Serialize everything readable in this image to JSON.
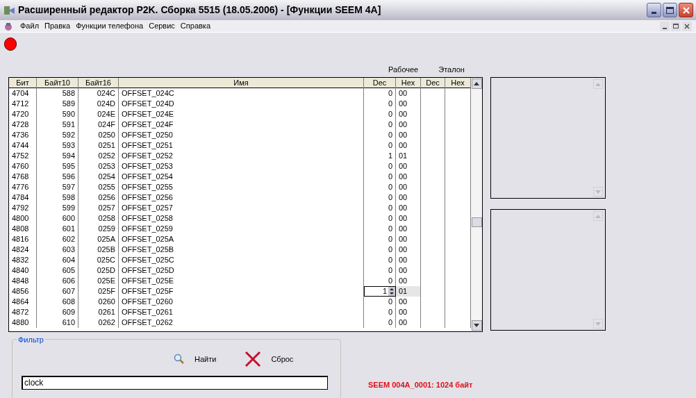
{
  "window": {
    "title": "Расширенный редактор P2K. Сборка 5515 (18.05.2006) - [Функции SEEM 4A]"
  },
  "menu": [
    "Файл",
    "Правка",
    "Функции телефона",
    "Сервис",
    "Справка"
  ],
  "group_headers": [
    "Рабочее",
    "Эталон"
  ],
  "table": {
    "columns": [
      "Бит",
      "Байт10",
      "Байт16",
      "Имя",
      "Dec",
      "Hex",
      "Dec",
      "Hex"
    ],
    "rows": [
      {
        "bit": "4704",
        "byte10": "588",
        "byte16": "024C",
        "name": "OFFSET_024C",
        "dec": "0",
        "hex": "00",
        "selected": false
      },
      {
        "bit": "4712",
        "byte10": "589",
        "byte16": "024D",
        "name": "OFFSET_024D",
        "dec": "0",
        "hex": "00",
        "selected": false
      },
      {
        "bit": "4720",
        "byte10": "590",
        "byte16": "024E",
        "name": "OFFSET_024E",
        "dec": "0",
        "hex": "00",
        "selected": false
      },
      {
        "bit": "4728",
        "byte10": "591",
        "byte16": "024F",
        "name": "OFFSET_024F",
        "dec": "0",
        "hex": "00",
        "selected": false
      },
      {
        "bit": "4736",
        "byte10": "592",
        "byte16": "0250",
        "name": "OFFSET_0250",
        "dec": "0",
        "hex": "00",
        "selected": false
      },
      {
        "bit": "4744",
        "byte10": "593",
        "byte16": "0251",
        "name": "OFFSET_0251",
        "dec": "0",
        "hex": "00",
        "selected": false
      },
      {
        "bit": "4752",
        "byte10": "594",
        "byte16": "0252",
        "name": "OFFSET_0252",
        "dec": "1",
        "hex": "01",
        "selected": false
      },
      {
        "bit": "4760",
        "byte10": "595",
        "byte16": "0253",
        "name": "OFFSET_0253",
        "dec": "0",
        "hex": "00",
        "selected": false
      },
      {
        "bit": "4768",
        "byte10": "596",
        "byte16": "0254",
        "name": "OFFSET_0254",
        "dec": "0",
        "hex": "00",
        "selected": false
      },
      {
        "bit": "4776",
        "byte10": "597",
        "byte16": "0255",
        "name": "OFFSET_0255",
        "dec": "0",
        "hex": "00",
        "selected": false
      },
      {
        "bit": "4784",
        "byte10": "598",
        "byte16": "0256",
        "name": "OFFSET_0256",
        "dec": "0",
        "hex": "00",
        "selected": false
      },
      {
        "bit": "4792",
        "byte10": "599",
        "byte16": "0257",
        "name": "OFFSET_0257",
        "dec": "0",
        "hex": "00",
        "selected": false
      },
      {
        "bit": "4800",
        "byte10": "600",
        "byte16": "0258",
        "name": "OFFSET_0258",
        "dec": "0",
        "hex": "00",
        "selected": false
      },
      {
        "bit": "4808",
        "byte10": "601",
        "byte16": "0259",
        "name": "OFFSET_0259",
        "dec": "0",
        "hex": "00",
        "selected": false
      },
      {
        "bit": "4816",
        "byte10": "602",
        "byte16": "025A",
        "name": "OFFSET_025A",
        "dec": "0",
        "hex": "00",
        "selected": false
      },
      {
        "bit": "4824",
        "byte10": "603",
        "byte16": "025B",
        "name": "OFFSET_025B",
        "dec": "0",
        "hex": "00",
        "selected": false
      },
      {
        "bit": "4832",
        "byte10": "604",
        "byte16": "025C",
        "name": "OFFSET_025C",
        "dec": "0",
        "hex": "00",
        "selected": false
      },
      {
        "bit": "4840",
        "byte10": "605",
        "byte16": "025D",
        "name": "OFFSET_025D",
        "dec": "0",
        "hex": "00",
        "selected": false
      },
      {
        "bit": "4848",
        "byte10": "606",
        "byte16": "025E",
        "name": "OFFSET_025E",
        "dec": "0",
        "hex": "00",
        "selected": false
      },
      {
        "bit": "4856",
        "byte10": "607",
        "byte16": "025F",
        "name": "OFFSET_025F",
        "dec": "1",
        "hex": "01",
        "selected": true
      },
      {
        "bit": "4864",
        "byte10": "608",
        "byte16": "0260",
        "name": "OFFSET_0260",
        "dec": "0",
        "hex": "00",
        "selected": false
      },
      {
        "bit": "4872",
        "byte10": "609",
        "byte16": "0261",
        "name": "OFFSET_0261",
        "dec": "0",
        "hex": "00",
        "selected": false
      },
      {
        "bit": "4880",
        "byte10": "610",
        "byte16": "0262",
        "name": "OFFSET_0262",
        "dec": "0",
        "hex": "00",
        "selected": false
      }
    ]
  },
  "filter": {
    "title": "Фильтр",
    "find_button": "Найти",
    "reset_button": "Сброс",
    "value": "clock"
  },
  "status": "SEEM 004A_0001: 1024 байт"
}
